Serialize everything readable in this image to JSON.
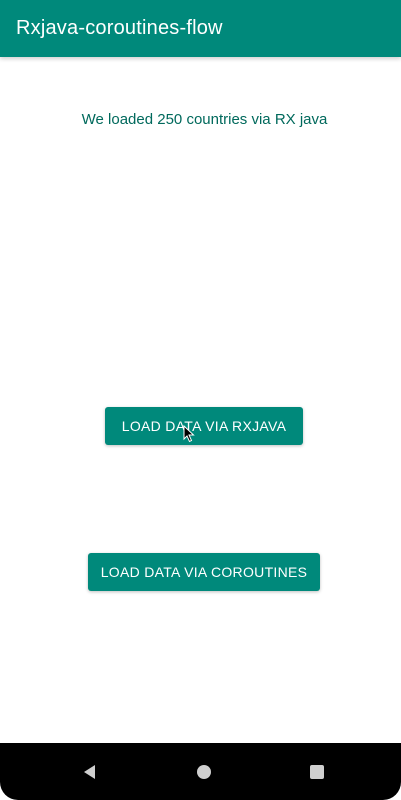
{
  "app_bar": {
    "title": "Rxjava-coroutines-flow",
    "background": "#00897b"
  },
  "main": {
    "status_text": "We loaded 250 countries via RX java",
    "buttons": {
      "rxjava_label": "LOAD DATA VIA RXJAVA",
      "coroutines_label": "LOAD DATA VIA COROUTINES"
    }
  },
  "icons": {
    "cursor": "mouse-pointer-icon",
    "back": "back-triangle-icon",
    "home": "home-circle-icon",
    "recents": "recents-square-icon"
  },
  "colors": {
    "primary": "#00897b",
    "status_text": "#00695c",
    "nav_bar": "#000000",
    "nav_icon": "#cfcfcf"
  }
}
